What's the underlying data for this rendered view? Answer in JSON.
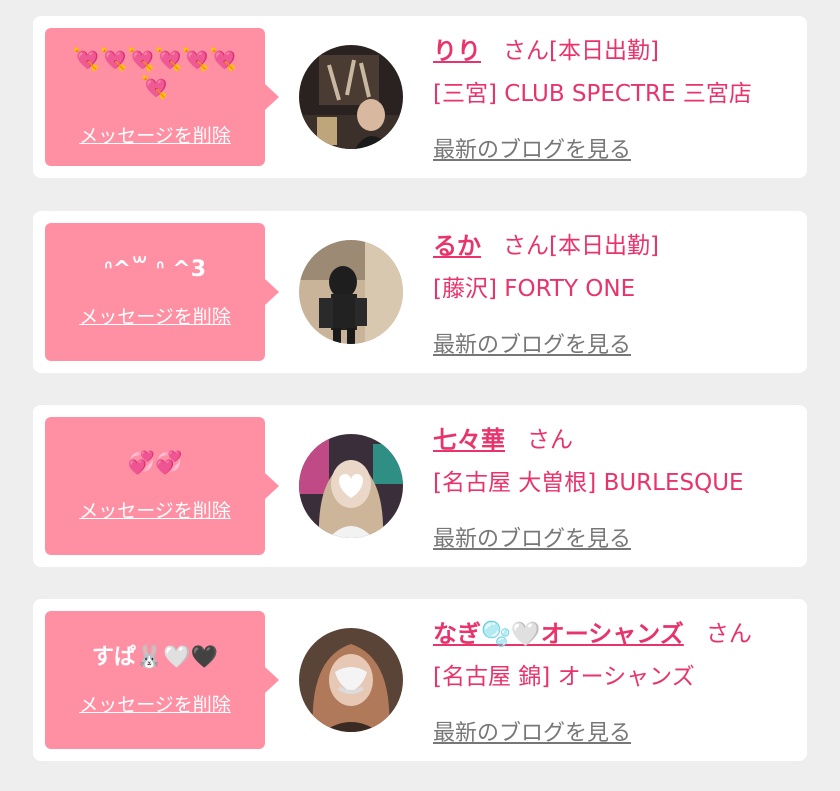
{
  "cards": [
    {
      "message": "💘💘💘💘💘💘💘",
      "delete_label": "メッセージを削除",
      "name": "りり",
      "honorific": "さん[本日出勤]",
      "shop": "[三宮] CLUB SPECTRE 三宮店",
      "blog_label": "最新のブログを見る"
    },
    {
      "message": "ᐢ^꒳ ᐢ ^3",
      "delete_label": "メッセージを削除",
      "name": "るか",
      "honorific": "さん[本日出勤]",
      "shop": "[藤沢] FORTY ONE",
      "blog_label": "最新のブログを見る"
    },
    {
      "message": "💞💞",
      "delete_label": "メッセージを削除",
      "name": "七々華",
      "honorific": "さん",
      "shop": "[名古屋 大曽根] BURLESQUE",
      "blog_label": "最新のブログを見る"
    },
    {
      "message": "すぱ🐰🤍🖤",
      "delete_label": "メッセージを削除",
      "name": "なぎ🫧🤍オーシャンズ",
      "honorific": "さん",
      "shop": "[名古屋 錦] オーシャンズ",
      "blog_label": "最新のブログを見る"
    }
  ],
  "colors": {
    "accent": "#e8336b",
    "bubble": "#ff8fa3",
    "background": "#eeeeee",
    "card": "#ffffff",
    "link_gray": "#777777"
  }
}
